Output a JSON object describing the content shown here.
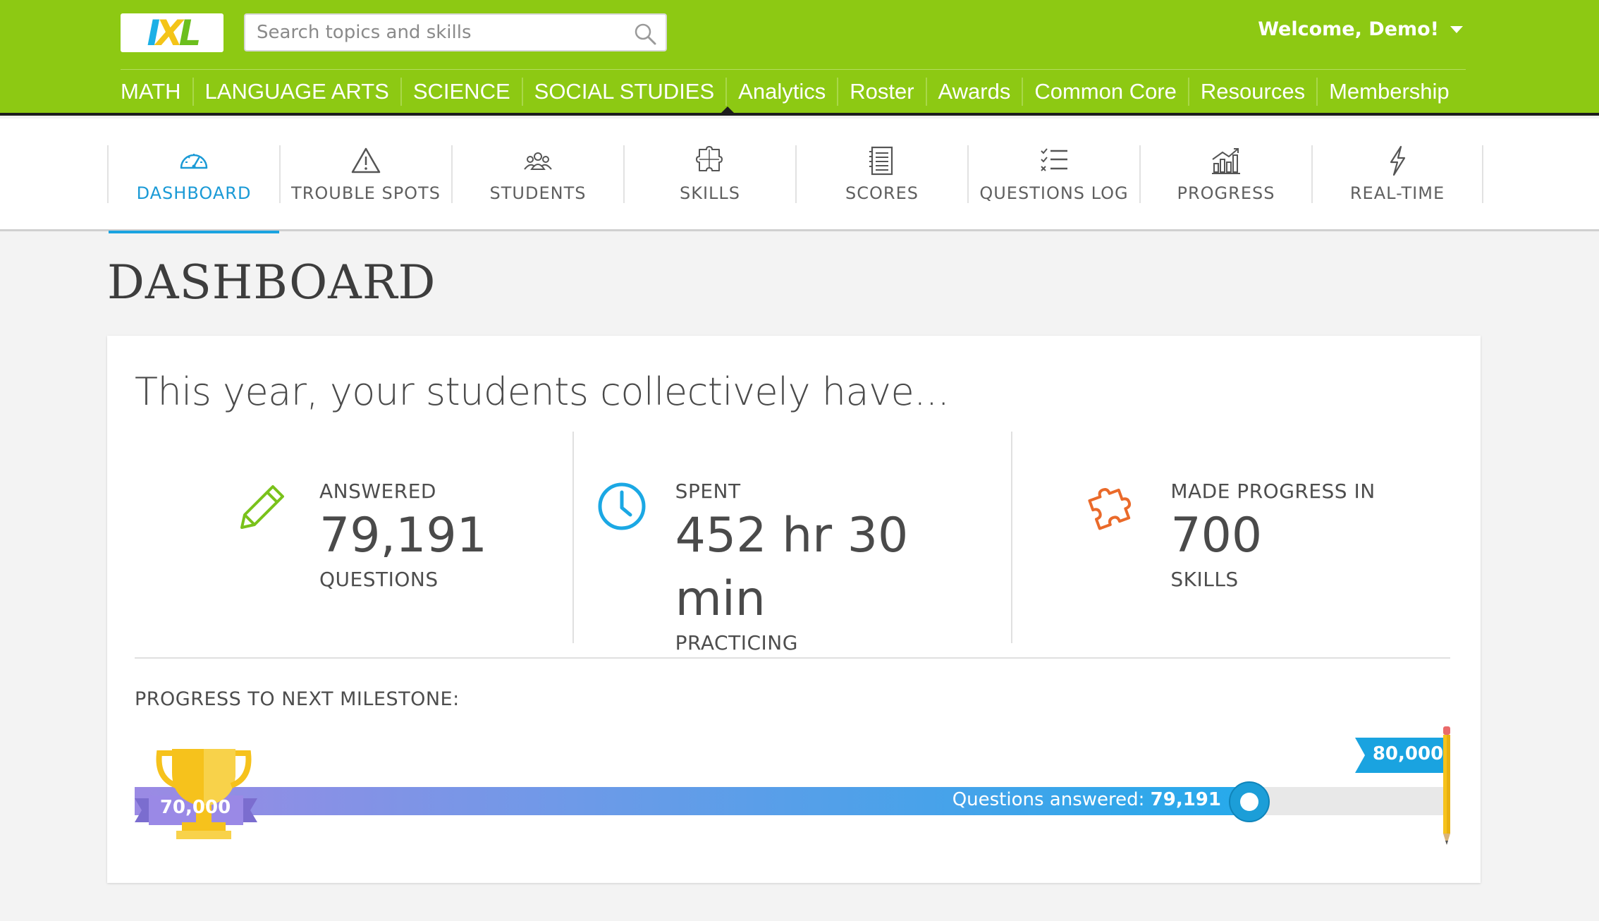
{
  "header": {
    "logo_text": "IXL",
    "search_placeholder": "Search topics and skills",
    "welcome": "Welcome, Demo!",
    "nav": [
      "MATH",
      "LANGUAGE ARTS",
      "SCIENCE",
      "SOCIAL STUDIES",
      "Analytics",
      "Roster",
      "Awards",
      "Common Core",
      "Resources",
      "Membership"
    ],
    "active_nav": "Analytics"
  },
  "subnav": {
    "tabs": [
      {
        "label": "DASHBOARD",
        "icon": "gauge-icon",
        "active": true
      },
      {
        "label": "TROUBLE SPOTS",
        "icon": "warning-icon",
        "active": false
      },
      {
        "label": "STUDENTS",
        "icon": "students-icon",
        "active": false
      },
      {
        "label": "SKILLS",
        "icon": "puzzle-icon",
        "active": false
      },
      {
        "label": "SCORES",
        "icon": "notebook-icon",
        "active": false
      },
      {
        "label": "QUESTIONS LOG",
        "icon": "checklist-icon",
        "active": false
      },
      {
        "label": "PROGRESS",
        "icon": "bar-chart-icon",
        "active": false
      },
      {
        "label": "REAL-TIME",
        "icon": "lightning-icon",
        "active": false
      }
    ]
  },
  "page": {
    "title": "DASHBOARD",
    "headline": "This year, your students collectively have...",
    "stats": [
      {
        "label": "ANSWERED",
        "value": "79,191",
        "sub": "QUESTIONS",
        "icon": "pencil-icon",
        "color": "#7ac21b"
      },
      {
        "label": "SPENT",
        "value": "452 hr 30 min",
        "sub": "PRACTICING",
        "icon": "clock-icon",
        "color": "#1ba8e4"
      },
      {
        "label": "MADE PROGRESS IN",
        "value": "700",
        "sub": "SKILLS",
        "icon": "puzzle-icon",
        "color": "#ea6a2a"
      }
    ],
    "milestone": {
      "label": "PROGRESS TO NEXT MILESTONE:",
      "start_label": "70,000",
      "end_label": "80,000",
      "start": 70000,
      "end": 80000,
      "current": 79191,
      "answered_prefix": "Questions answered:",
      "answered_value": "79,191"
    }
  },
  "colors": {
    "header_green": "#8dc913",
    "accent_blue": "#1aa3e0",
    "trophy_gold": "#f6c21c"
  }
}
